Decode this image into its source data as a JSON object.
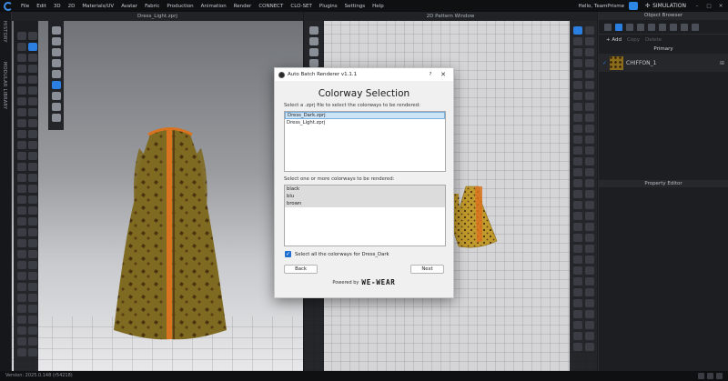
{
  "menubar": {
    "items": [
      "File",
      "Edit",
      "3D",
      "2D",
      "Materials/UV",
      "Avatar",
      "Fabric",
      "Production",
      "Animation",
      "Render",
      "CONNECT",
      "CLO-SET",
      "Plugins",
      "Settings",
      "Help"
    ],
    "user": "Hello, TeamPrisme",
    "mode": "SIMULATION"
  },
  "left_tabs": {
    "history": "HISTORY",
    "modular": "MODULAR LIBRARY"
  },
  "view3d": {
    "title": "Dress_Light.zprj"
  },
  "view2d": {
    "title": "2D Pattern Window"
  },
  "right_panel": {
    "object_browser": "Object Browser",
    "add_label": "+ Add",
    "copy_label": "Copy",
    "delete_label": "Delete",
    "primary": "Primary",
    "fabric_name": "CHIFFON_1",
    "property_editor": "Property Editor"
  },
  "dialog": {
    "title": "Auto Batch Renderer v1.1.1",
    "help": "?",
    "close": "✕",
    "heading": "Colorway Selection",
    "file_label": "Select a .zprj file to select the colorways to be rendered:",
    "files": [
      "Dress_Dark.zprj",
      "Dress_Light.zprj"
    ],
    "colorway_label": "Select one or more colorways to be rendered:",
    "colorways": [
      "black",
      "blu",
      "brown"
    ],
    "select_all": "Select all the colorways for Dress_Dark",
    "back": "Back",
    "next": "Next",
    "powered_by": "Powered by",
    "brand": "WE-WEAR"
  },
  "status": {
    "version": "Version: 2025.0.148 (r54218)"
  },
  "colors": {
    "accent": "#2b7fe0",
    "fabric": "#8b6b1c",
    "stripe": "#d9731f"
  }
}
